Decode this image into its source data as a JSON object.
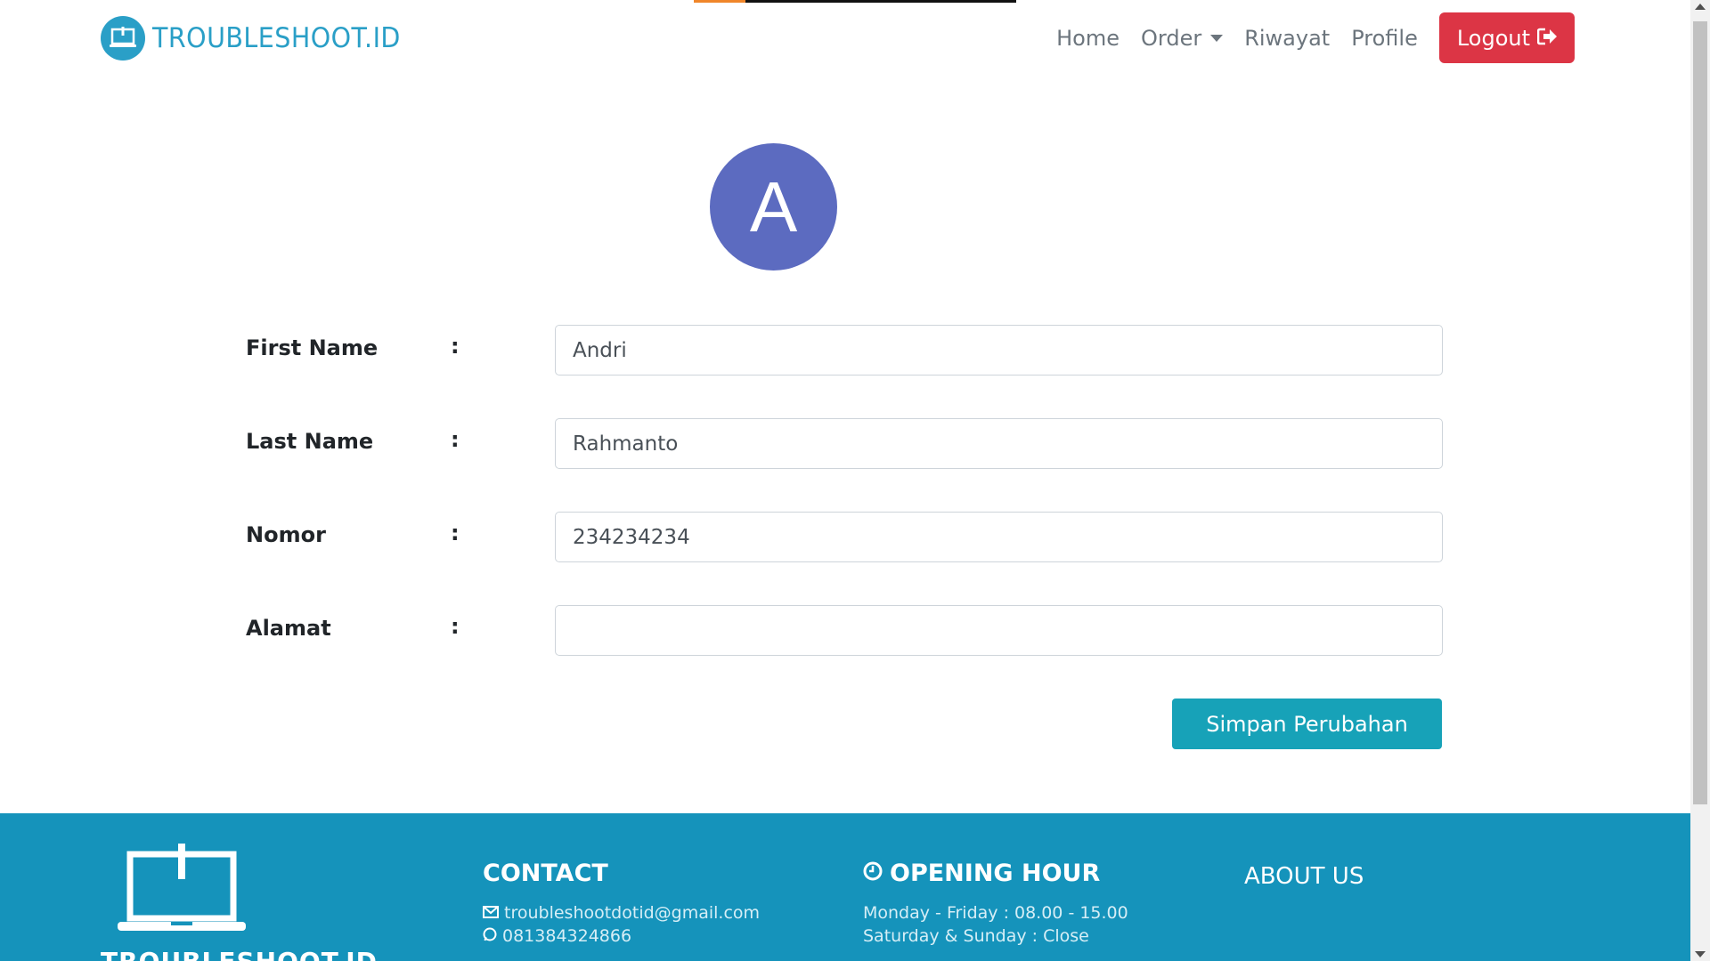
{
  "progress": {
    "fraction": 0.16
  },
  "brand": {
    "name": "TROUBLESHOOT.ID",
    "icon": "laptop-icon",
    "color": "#2a9fc7"
  },
  "nav": {
    "items": [
      {
        "label": "Home"
      },
      {
        "label": "Order"
      },
      {
        "label": "Riwayat"
      },
      {
        "label": "Profile"
      }
    ],
    "logout_label": "Logout",
    "logout_icon": "sign-out-icon",
    "logout_color": "#dc3545"
  },
  "profile": {
    "avatar_letter": "A",
    "avatar_color": "#5c6bc0"
  },
  "form": {
    "colon": ":",
    "fields": [
      {
        "label": "First Name",
        "value": "Andri"
      },
      {
        "label": "Last Name",
        "value": "Rahmanto"
      },
      {
        "label": "Nomor",
        "value": "234234234"
      },
      {
        "label": "Alamat",
        "value": ""
      }
    ],
    "save_label": "Simpan Perubahan",
    "save_color": "#17a2b8"
  },
  "footer": {
    "bg_color": "#1593bb",
    "brand": "TROUBLESHOOT.ID",
    "contact": {
      "title": "CONTACT",
      "email": "troubleshootdotid@gmail.com",
      "phone": "081384324866"
    },
    "hours": {
      "title": "OPENING HOUR",
      "weekdays": "Monday - Friday : 08.00 - 15.00",
      "weekend": "Saturday & Sunday : Close"
    },
    "about": {
      "title": "ABOUT US"
    }
  }
}
